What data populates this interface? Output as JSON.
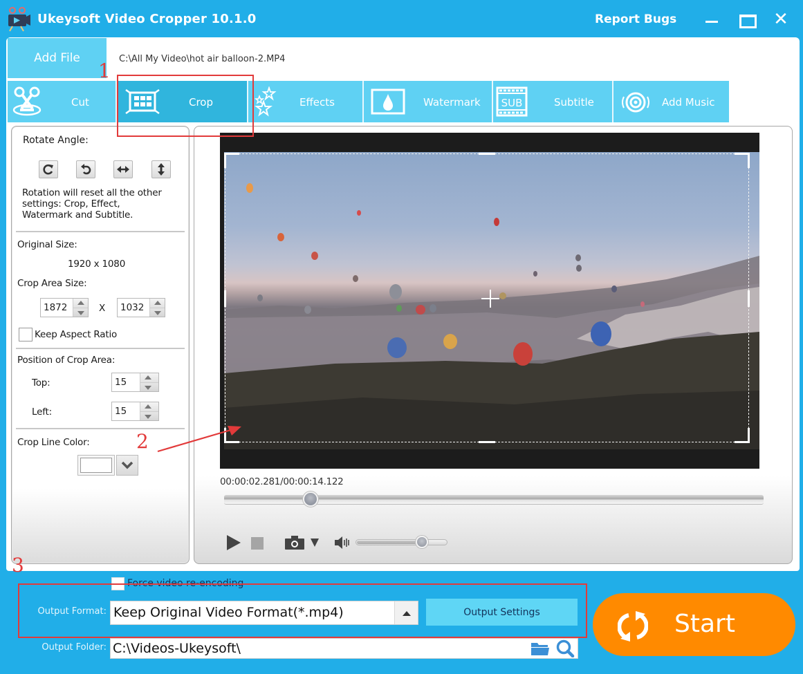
{
  "window": {
    "title": "Ukeysoft Video Cropper 10.1.0",
    "report_bugs": "Report Bugs",
    "minimize_icon": "minimize-icon",
    "maximize_icon": "maximize-icon",
    "close_label": "✕"
  },
  "file": {
    "add_file_label": "Add File",
    "path": "C:\\All My Video\\hot air balloon-2.MP4"
  },
  "tabs": [
    {
      "id": "cut",
      "label": "Cut",
      "icon": "scissors-icon",
      "active": false
    },
    {
      "id": "crop",
      "label": "Crop",
      "icon": "crop-frame-icon",
      "active": true
    },
    {
      "id": "effects",
      "label": "Effects",
      "icon": "stars-icon",
      "active": false
    },
    {
      "id": "watermark",
      "label": "Watermark",
      "icon": "drop-icon",
      "active": false
    },
    {
      "id": "subtitle",
      "label": "Subtitle",
      "icon": "sub-film-icon",
      "active": false
    },
    {
      "id": "music",
      "label": "Add Music",
      "icon": "speaker-target-icon",
      "active": false
    }
  ],
  "crop_panel": {
    "rotate_label": "Rotate Angle:",
    "rotate_buttons": [
      "rotate-clockwise-icon",
      "rotate-counterclockwise-icon",
      "flip-horizontal-icon",
      "flip-vertical-icon"
    ],
    "rotation_note_lines": [
      "Rotation will reset all the other",
      "settings: Crop, Effect,",
      "Watermark and Subtitle."
    ],
    "original_size_label": "Original Size:",
    "original_size_value": "1920 x 1080",
    "crop_area_label": "Crop Area Size:",
    "crop_width": "1872",
    "crop_x_sep": "X",
    "crop_height": "1032",
    "keep_aspect_label": "Keep Aspect Ratio",
    "keep_aspect_checked": false,
    "position_label": "Position of Crop Area:",
    "top_label": "Top:",
    "top_value": "15",
    "left_label": "Left:",
    "left_value": "15",
    "line_color_label": "Crop Line Color:",
    "line_color": "#ffffff"
  },
  "player": {
    "current_time": "00:00:02.281",
    "separator": "/",
    "total_time": "00:00:14.122",
    "progress_fraction": 0.16,
    "volume_fraction": 0.72
  },
  "output": {
    "force_reencode_label": "Force video re-encoding",
    "force_reencode_checked": false,
    "format_label": "Output Format:",
    "format_value": "Keep Original Video Format(*.mp4)",
    "settings_label": "Output Settings",
    "folder_label": "Output Folder:",
    "folder_value": "C:\\Videos-Ukeysoft\\",
    "start_label": "Start"
  },
  "annotations": [
    {
      "number": "1",
      "target": "crop tab"
    },
    {
      "number": "2",
      "target": "crop area on video preview"
    },
    {
      "number": "3",
      "target": "output format settings"
    }
  ],
  "colors": {
    "brand_blue": "#21aee8",
    "tab_blue": "#5fd1f3",
    "tab_active": "#30b5dd",
    "start_orange": "#ff8a00",
    "annotation_red": "#e23a3a"
  }
}
